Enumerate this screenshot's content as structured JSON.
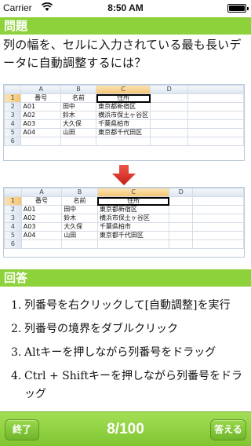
{
  "status_bar": {
    "carrier": "Carrier",
    "time": "8:50 AM"
  },
  "question": {
    "header": "問題",
    "text": "列の幅を、セルに入力されている最も長いデータに自動調整するには？"
  },
  "spreadsheet": {
    "columns": [
      "A",
      "B",
      "C",
      "D"
    ],
    "rows": [
      "1",
      "2",
      "3",
      "4",
      "5",
      "6"
    ],
    "header_row": [
      "番号",
      "名前",
      "住所",
      ""
    ],
    "data": [
      [
        "A01",
        "田中",
        "東京都新宿区",
        ""
      ],
      [
        "A02",
        "鈴木",
        "横浜市保土ヶ谷区",
        ""
      ],
      [
        "A03",
        "大久保",
        "千葉県柏市",
        ""
      ],
      [
        "A04",
        "山田",
        "東京都千代田区",
        ""
      ]
    ]
  },
  "answer": {
    "header": "回答",
    "items": [
      {
        "num": "1.",
        "text": "列番号を右クリックして[自動調整]を実行"
      },
      {
        "num": "2.",
        "text": "列番号の境界をダブルクリック"
      },
      {
        "num": "3.",
        "text": "Altキーを押しながら列番号をドラッグ"
      },
      {
        "num": "4.",
        "text": "Ctrl + Shiftキーを押しながら列番号をドラッグ"
      }
    ]
  },
  "toolbar": {
    "quit_label": "終了",
    "counter": "8/100",
    "answer_label": "答える"
  },
  "colors": {
    "accent_green": "#8dd23a",
    "arrow_red": "#e0302a"
  }
}
